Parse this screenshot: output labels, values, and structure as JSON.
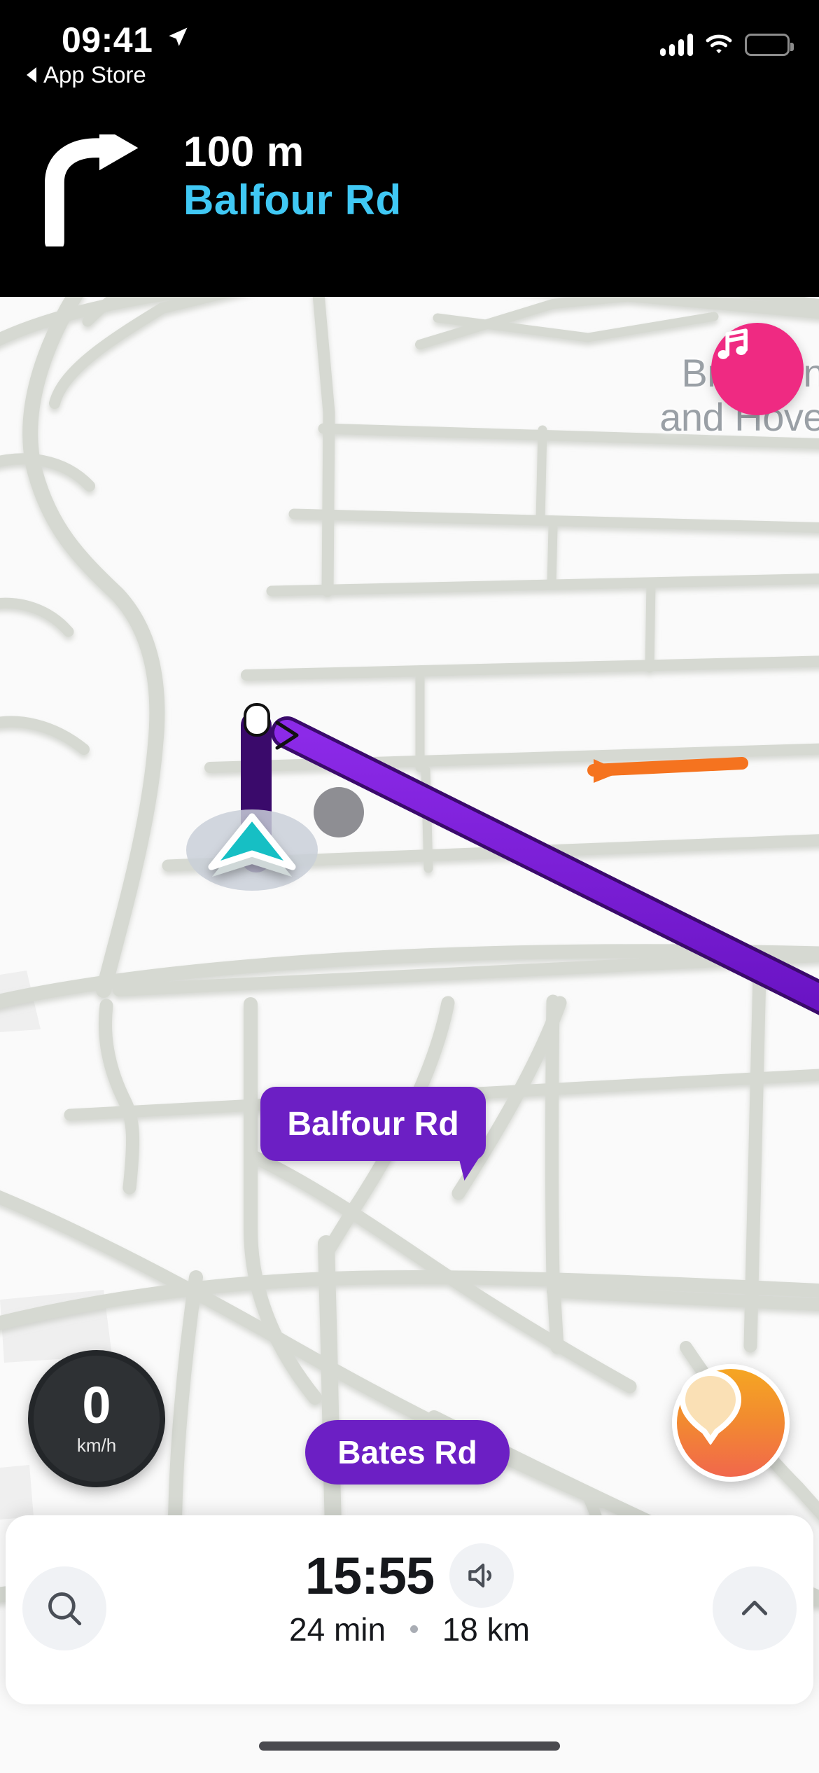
{
  "status_bar": {
    "time": "09:41",
    "back_app_label": "App Store",
    "location_icon": "location-arrow-icon",
    "signal_icon": "cellular-signal-icon",
    "wifi_icon": "wifi-icon",
    "battery_icon": "battery-low-power-icon",
    "battery_color": "#ffdd20"
  },
  "navigation_banner": {
    "maneuver_icon": "turn-right-arrow-icon",
    "distance": "100 m",
    "street": "Balfour Rd",
    "street_color": "#40c8f4",
    "background_color": "#000000"
  },
  "map": {
    "city_label": "Brighton\nand Hove",
    "city_label_line1": "Brighton",
    "city_label_line2": "and Hove",
    "background_color": "#fafafa",
    "road_color": "#d6d9d2",
    "route_color": "#7b20d8",
    "route_outline_color": "#3a0a6b",
    "incident_color": "#f5731f",
    "labels": [
      {
        "text": "Balfour Rd",
        "type": "street-bubble"
      },
      {
        "text": "Bates Rd",
        "type": "street-bubble"
      }
    ],
    "user_marker": {
      "icon": "navigation-arrow-marker",
      "color": "#13bfc4"
    },
    "poi_marker": {
      "icon": "gray-dot-marker",
      "color": "#8e8e93"
    }
  },
  "music_button": {
    "icon": "music-note-icon",
    "color": "#ef2a82"
  },
  "speedometer": {
    "value": "0",
    "unit": "km/h"
  },
  "report_button": {
    "icon": "report-pin-icon",
    "color_start": "#f5a623",
    "color_end": "#f1674c"
  },
  "bottom_sheet": {
    "search_icon": "search-icon",
    "expand_icon": "chevron-up-icon",
    "sound_icon": "speaker-on-icon",
    "eta_time": "15:55",
    "duration": "24 min",
    "distance": "18 km"
  }
}
